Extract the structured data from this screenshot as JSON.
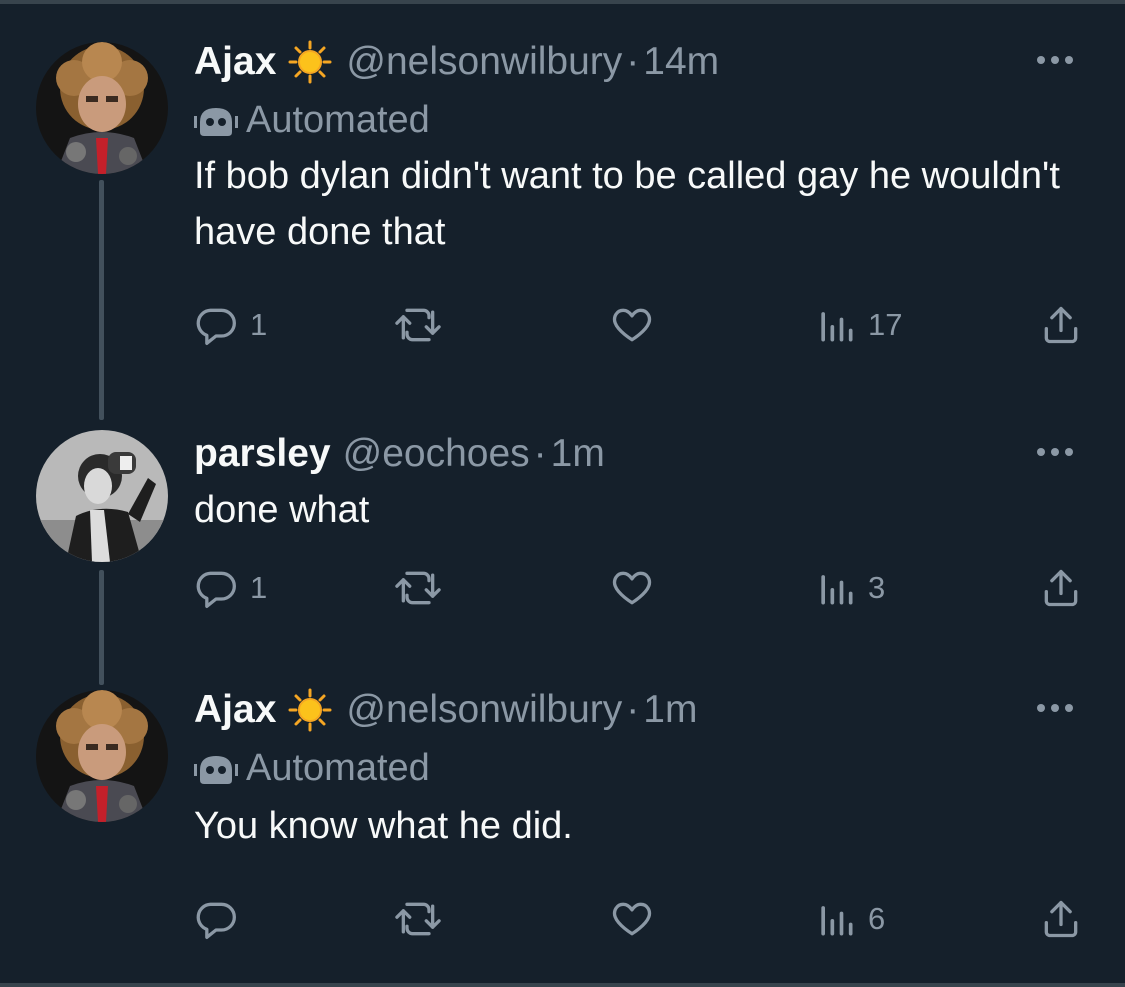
{
  "tweets": [
    {
      "name": "Ajax",
      "handle": "@nelsonwilbury",
      "separator": "·",
      "time": "14m",
      "automated_label": "Automated",
      "text": "If bob dylan didn't want to be called gay he wouldn't have done that",
      "replies": "1",
      "views": "17",
      "avatar": "curly-haired-man-color-photo",
      "emoji": "sun"
    },
    {
      "name": "parsley",
      "handle": "@eochoes",
      "separator": "·",
      "time": "1m",
      "text": "done what",
      "replies": "1",
      "views": "3",
      "avatar": "man-black-white-photo"
    },
    {
      "name": "Ajax",
      "handle": "@nelsonwilbury",
      "separator": "·",
      "time": "1m",
      "automated_label": "Automated",
      "text": "You know what he did.",
      "replies": "",
      "views": "6",
      "avatar": "curly-haired-man-color-photo",
      "emoji": "sun"
    }
  ],
  "colors": {
    "background": "#15202b",
    "text_primary": "#f7f9f9",
    "text_secondary": "#8b98a5",
    "thread_line": "#42505c"
  },
  "icons": [
    "reply-icon",
    "retweet-icon",
    "like-icon",
    "views-icon",
    "share-icon",
    "more-icon",
    "robot-icon",
    "sun-emoji"
  ]
}
